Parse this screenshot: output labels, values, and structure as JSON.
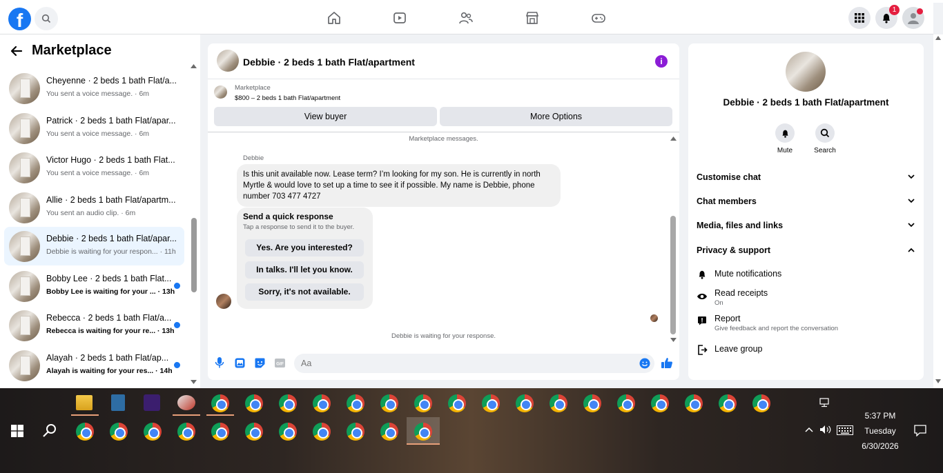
{
  "colors": {
    "brand": "#1877f2",
    "unread_dot": "#1877f2",
    "info": "#8b1dd6",
    "badge": "#e41e3f"
  },
  "topbar": {
    "logo_letter": "f",
    "notification_count": "1",
    "icons": [
      "facebook-logo",
      "search-icon",
      "home-icon",
      "video-icon",
      "friends-icon",
      "marketplace-icon",
      "gaming-icon",
      "menu-grid-icon",
      "bell-icon",
      "profile-avatar"
    ]
  },
  "sidebar": {
    "title": "Marketplace",
    "conversations": [
      {
        "name": "Cheyenne · 2 beds 1 bath Flat/a...",
        "preview": "You sent a voice message. · 6m",
        "unread": false
      },
      {
        "name": "Patrick · 2 beds 1 bath Flat/apar...",
        "preview": "You sent a voice message. · 6m",
        "unread": false
      },
      {
        "name": "Victor Hugo · 2 beds 1 bath Flat...",
        "preview": "You sent a voice message. · 6m",
        "unread": false
      },
      {
        "name": "Allie · 2 beds 1 bath Flat/apartm...",
        "preview": "You sent an audio clip. · 6m",
        "unread": false
      },
      {
        "name": "Debbie · 2 beds 1 bath Flat/apar...",
        "preview": "Debbie is waiting for your respon... · 11h",
        "unread": false,
        "active": true
      },
      {
        "name": "Bobby Lee · 2 beds 1 bath Flat...",
        "preview": "Bobby Lee is waiting for your ... · 13h",
        "unread": true
      },
      {
        "name": "Rebecca · 2 beds 1 bath Flat/a...",
        "preview": "Rebecca is waiting for your re... · 13h",
        "unread": true
      },
      {
        "name": "Alayah · 2 beds 1 bath Flat/ap...",
        "preview": "Alayah is waiting for your res... · 14h",
        "unread": true
      }
    ]
  },
  "chat": {
    "title": "Debbie · 2 beds 1 bath Flat/apartment",
    "listing_source": "Marketplace",
    "listing_price": "$800 – 2 beds 1 bath Flat/apartment",
    "view_buyer_label": "View buyer",
    "more_options_label": "More Options",
    "system_top": "Marketplace messages.",
    "sender": "Debbie",
    "message": "Is this unit available now. Lease term?  I’m looking for my son. He is currently in north Myrtle & would love to set up a time to see it if possible. My name is Debbie, phone number 703 477 4727",
    "quick_response_title": "Send a quick response",
    "quick_response_sub": "Tap a response to send it to the buyer.",
    "quick_responses": [
      "Yes. Are you interested?",
      "In talks. I'll let you know.",
      "Sorry, it's not available."
    ],
    "waiting_text": "Debbie is waiting for your response.",
    "input_placeholder": "Aa"
  },
  "details": {
    "title": "Debbie · 2 beds 1 bath Flat/apartment",
    "actions": [
      "Mute",
      "Search"
    ],
    "sections": [
      "Customise chat",
      "Chat members",
      "Media, files and links",
      "Privacy & support"
    ],
    "privacy_items": [
      {
        "label": "Mute notifications",
        "desc": ""
      },
      {
        "label": "Read receipts",
        "desc": "On"
      },
      {
        "label": "Report",
        "desc": "Give feedback and report the conversation"
      },
      {
        "label": "Leave group",
        "desc": ""
      }
    ]
  },
  "taskbar": {
    "time": "5:37 PM",
    "day": "Tuesday",
    "date": "6/30/2026"
  }
}
